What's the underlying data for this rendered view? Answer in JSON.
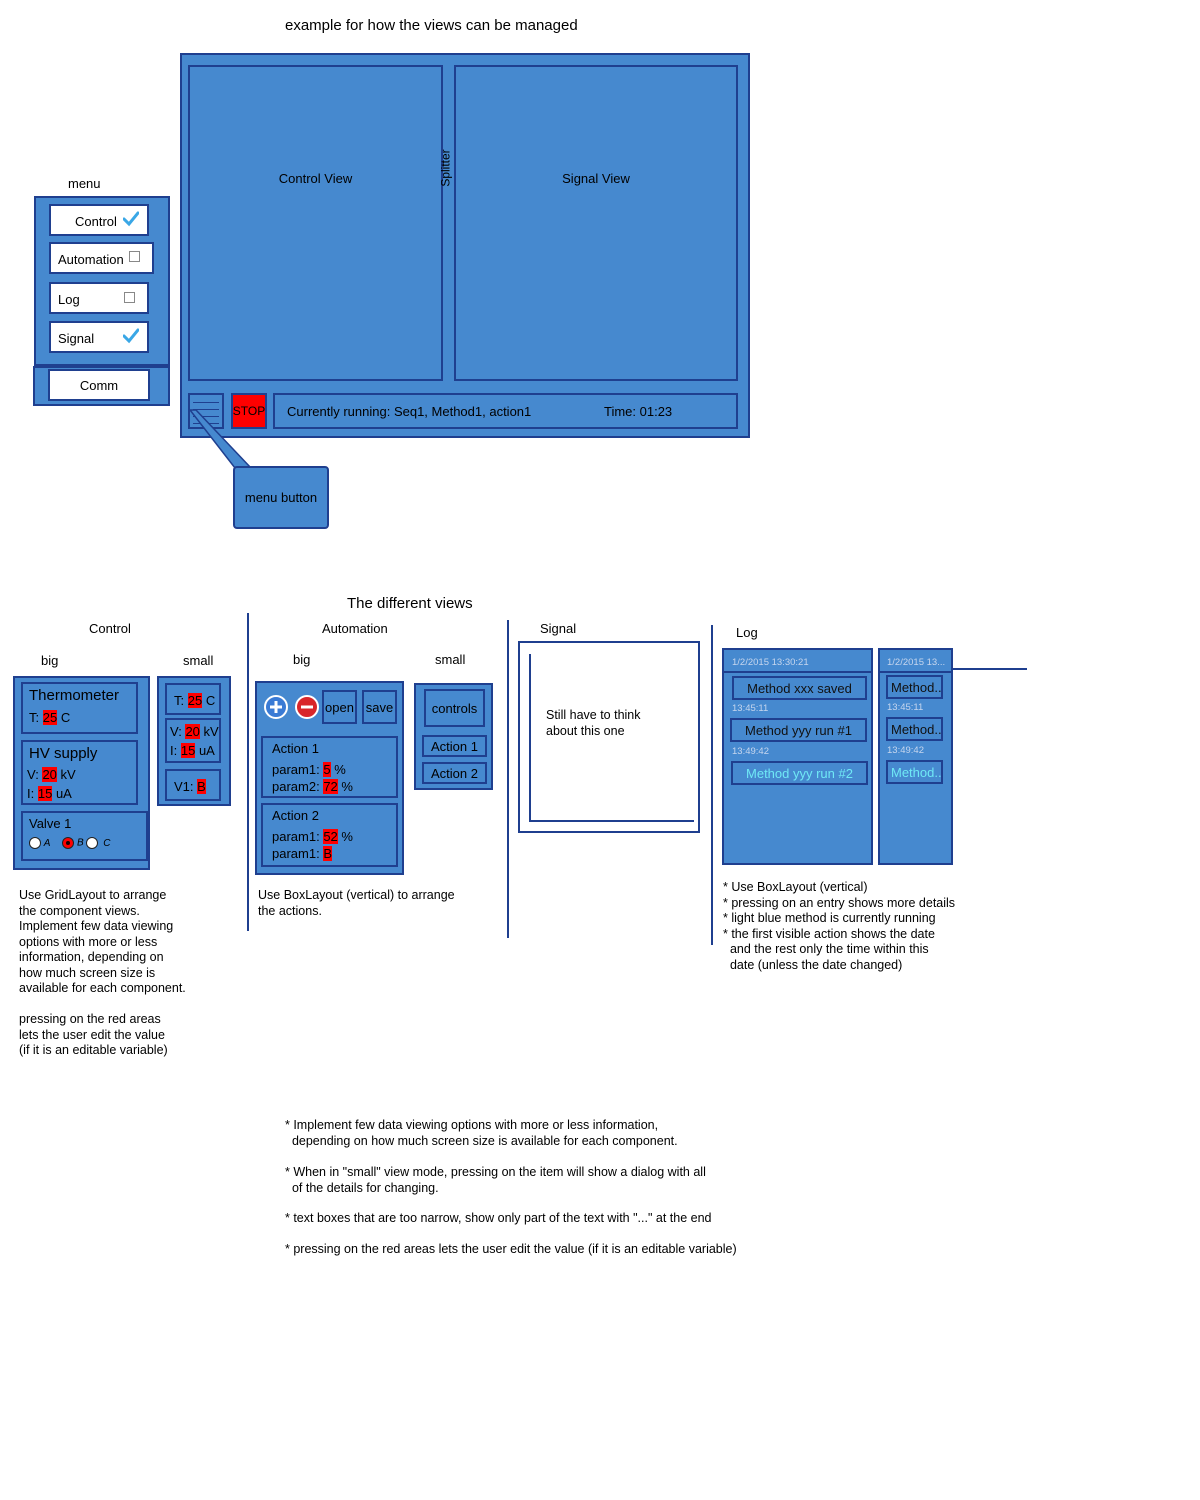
{
  "top": {
    "title": "example for how the views can be managed",
    "control_view": "Control View",
    "signal_view": "Signal View",
    "splitter": "Splitter",
    "stop": "STOP",
    "status": "Currently running: Seq1, Method1, action1",
    "time": "Time: 01:23",
    "menu_button_callout": "menu button"
  },
  "menu": {
    "title": "menu",
    "items": [
      {
        "label": "Control",
        "checked": true
      },
      {
        "label": "Automation",
        "checked": false
      },
      {
        "label": "Log",
        "checked": false
      },
      {
        "label": "Signal",
        "checked": true
      }
    ],
    "comm": "Comm"
  },
  "views": {
    "title": "The different views",
    "control": {
      "header": "Control",
      "big_label": "big",
      "small_label": "small",
      "big": {
        "thermo_title": "Thermometer",
        "thermo_prefix": "T:",
        "thermo_value": "25",
        "thermo_unit": "C",
        "hv_title": "HV supply",
        "v_prefix": "V:",
        "v_value": "20",
        "v_unit": "kV",
        "i_prefix": "I:",
        "i_value": "15",
        "i_unit": "uA",
        "valve_title": "Valve 1",
        "opt_a": "A",
        "opt_b": "B",
        "opt_c": "C"
      },
      "small": {
        "t_prefix": "T:",
        "t_value": "25",
        "t_unit": "C",
        "v_prefix": "V:",
        "v_value": "20",
        "v_unit": "kV",
        "i_prefix": "I:",
        "i_value": "15",
        "i_unit": "uA",
        "valve_prefix": "V1:",
        "valve_value": "B"
      },
      "note": "Use GridLayout to arrange\nthe component views.\nImplement few data viewing\noptions with more or less\ninformation, depending on\nhow much screen size is\navailable for each component.\n\npressing on the red areas\nlets the user edit the value\n(if it is an editable variable)"
    },
    "automation": {
      "header": "Automation",
      "big_label": "big",
      "small_label": "small",
      "open": "open",
      "save": "save",
      "action1_title": "Action 1",
      "param1_label": "param1:",
      "a1_param1_value": "5",
      "a1_param1_unit": "%",
      "param2_label": "param2:",
      "a1_param2_value": "72",
      "a1_param2_unit": "%",
      "action2_title": "Action 2",
      "a2_param1_value": "52",
      "a2_param1_unit": "%",
      "a2_param2_value": "B",
      "small_controls": "controls",
      "small_action1": "Action 1",
      "small_action2": "Action 2",
      "note": "Use BoxLayout (vertical) to arrange\nthe actions."
    },
    "signal": {
      "header": "Signal",
      "text": "Still have to think\nabout this one"
    },
    "log": {
      "header": "Log",
      "date1": "1/2/2015 13:30:21",
      "entry1": "Method xxx saved",
      "time2": "13:45:11",
      "entry2": "Method yyy run #1",
      "time3": "13:49:42",
      "entry3": "Method yyy run #2",
      "small_date": "1/2/2015 13...",
      "small_entry": "Method..",
      "note": "* Use BoxLayout (vertical)\n* pressing on an entry shows more details\n* light blue method is currently running\n* the first visible action shows the date\n  and the rest only the time within this\n  date (unless the date changed)"
    }
  },
  "bottom_notes": [
    "* Implement few data viewing options with more or less information,\n  depending on how much screen size is available for each component.",
    "* When in \"small\" view mode, pressing on the item will show a dialog with all\n  of the details for changing.",
    "* text boxes that are too narrow, show only part of the text with \"...\" at the end",
    "* pressing on the red areas lets the user edit the value (if it is an editable variable)"
  ],
  "colors": {
    "panel_blue": "#4689cf",
    "border_navy": "#1f3f8f",
    "edit_red": "#ff0000",
    "running_cyan": "#6fe8f5"
  }
}
